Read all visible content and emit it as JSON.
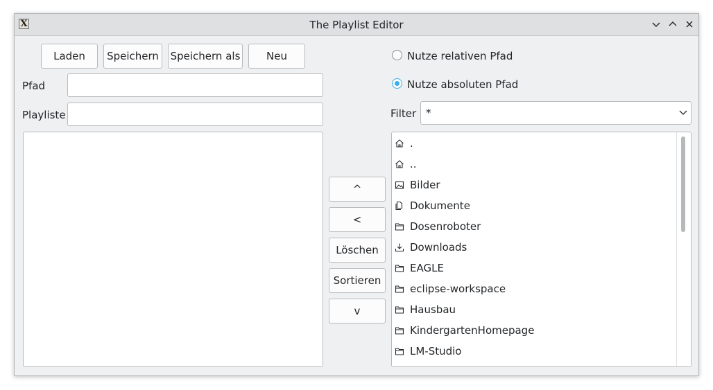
{
  "window": {
    "title": "The Playlist Editor",
    "icon_glyph": "X"
  },
  "toolbar": {
    "load_label": "Laden",
    "save_label": "Speichern",
    "save_as_label": "Speichern als",
    "new_label": "Neu"
  },
  "form": {
    "path_label": "Pfad",
    "path_value": "",
    "playlist_label": "Playliste",
    "playlist_value": ""
  },
  "options": {
    "relative_label": "Nutze relativen Pfad",
    "relative_selected": false,
    "absolute_label": "Nutze absoluten Pfad",
    "absolute_selected": true
  },
  "filter": {
    "label": "Filter",
    "value": "*"
  },
  "controls": {
    "up_label": "^",
    "left_label": "<",
    "delete_label": "Löschen",
    "sort_label": "Sortieren",
    "down_label": "v"
  },
  "files": [
    {
      "name": ".",
      "icon": "home-icon"
    },
    {
      "name": "..",
      "icon": "home-icon"
    },
    {
      "name": "Bilder",
      "icon": "pictures-folder-icon"
    },
    {
      "name": "Dokumente",
      "icon": "documents-folder-icon"
    },
    {
      "name": "Dosenroboter",
      "icon": "folder-icon"
    },
    {
      "name": "Downloads",
      "icon": "download-folder-icon"
    },
    {
      "name": "EAGLE",
      "icon": "folder-icon"
    },
    {
      "name": "eclipse-workspace",
      "icon": "folder-icon"
    },
    {
      "name": "Hausbau",
      "icon": "folder-icon"
    },
    {
      "name": "KindergartenHomepage",
      "icon": "folder-icon"
    },
    {
      "name": "LM-Studio",
      "icon": "folder-icon"
    }
  ],
  "colors": {
    "accent": "#3daee9",
    "window_bg": "#eff0f1",
    "titlebar_bg": "#dee0e2"
  }
}
